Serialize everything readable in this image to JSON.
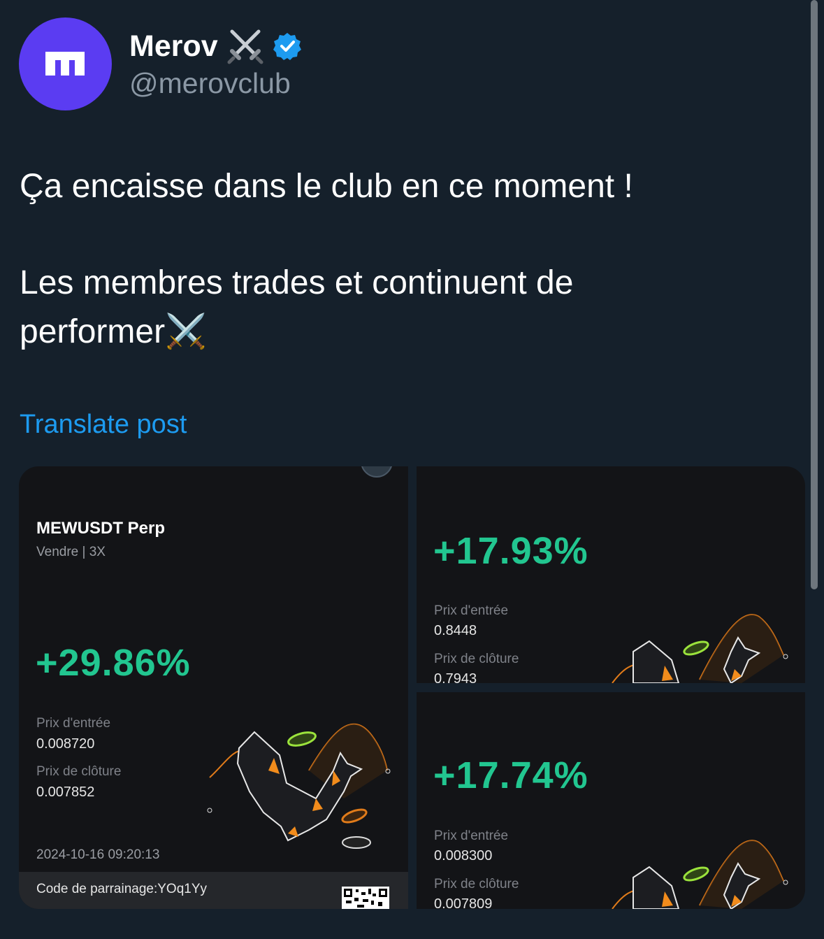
{
  "author": {
    "name": "Merov",
    "name_emoji": "⚔️",
    "handle": "@merovclub",
    "verified": true,
    "avatar_letter": "m",
    "avatar_color": "#5b3cf2"
  },
  "post": {
    "line1": "Ça encaisse dans le club en ce moment !",
    "line2": "Les membres trades et continuent de",
    "line3": "performer⚔️"
  },
  "translate_label": "Translate post",
  "cards": {
    "left": {
      "pair": "MEWUSDT Perp",
      "side": "Vendre  |  3X",
      "pnl": "+29.86%",
      "entry_label": "Prix d'entrée",
      "entry_value": "0.008720",
      "close_label": "Prix de clôture",
      "close_value": "0.007852",
      "timestamp": "2024-10-16 09:20:13",
      "referral": "Code de parrainage:YOq1Yy"
    },
    "top_right": {
      "pnl": "+17.93%",
      "entry_label": "Prix d'entrée",
      "entry_value": "0.8448",
      "close_label": "Prix de clôture",
      "close_value": "0.7943"
    },
    "bottom_right": {
      "pnl": "+17.74%",
      "entry_label": "Prix d'entrée",
      "entry_value": "0.008300",
      "close_label": "Prix de clôture",
      "close_value": "0.007809"
    }
  },
  "colors": {
    "background": "#15202b",
    "accent_link": "#1d9bf0",
    "profit_green": "#22c690",
    "card_bg": "#131417",
    "verified_blue": "#1d9bf0"
  }
}
